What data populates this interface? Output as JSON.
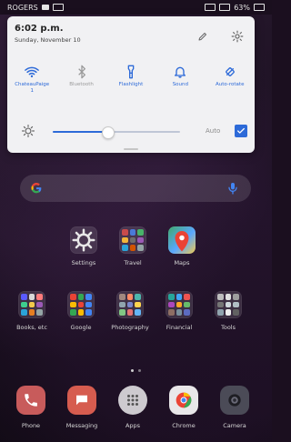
{
  "status_bar": {
    "carrier": "ROGERS",
    "battery_percent": "63%"
  },
  "quick_settings": {
    "time": "6:02 p.m.",
    "date": "Sunday, November 10",
    "toggles": [
      {
        "label": "ChateauPaige\n1",
        "icon": "wifi-icon",
        "state": "on"
      },
      {
        "label": "Bluetooth",
        "icon": "bluetooth-icon",
        "state": "off"
      },
      {
        "label": "Flashlight",
        "icon": "flashlight-icon",
        "state": "on"
      },
      {
        "label": "Sound",
        "icon": "bell-icon",
        "state": "on"
      },
      {
        "label": "Auto-rotate",
        "icon": "auto-rotate-icon",
        "state": "on"
      }
    ],
    "brightness": {
      "level": 0.43,
      "auto_label": "Auto",
      "auto_checked": true
    }
  },
  "home": {
    "search": {
      "icon_left": "google-g-icon",
      "icon_right": "microphone-icon"
    },
    "apps_row_1": [
      {
        "label": "Settings",
        "icon": "settings-icon"
      },
      {
        "label": "Travel",
        "icon": "folder-icon"
      },
      {
        "label": "Maps",
        "icon": "maps-icon"
      }
    ],
    "apps_row_2": [
      {
        "label": "Books, etc",
        "icon": "folder-icon"
      },
      {
        "label": "Google",
        "icon": "folder-icon"
      },
      {
        "label": "Photography",
        "icon": "folder-icon"
      },
      {
        "label": "Financial",
        "icon": "folder-icon"
      },
      {
        "label": "Tools",
        "icon": "folder-icon"
      }
    ],
    "dock": [
      {
        "label": "Phone",
        "icon": "phone-icon"
      },
      {
        "label": "Messaging",
        "icon": "message-icon"
      },
      {
        "label": "Apps",
        "icon": "app-drawer-icon"
      },
      {
        "label": "Chrome",
        "icon": "chrome-icon"
      },
      {
        "label": "Camera",
        "icon": "camera-icon"
      }
    ]
  },
  "colors": {
    "accent": "#2d6ad8",
    "shade_bg": "#f1f1f3"
  }
}
